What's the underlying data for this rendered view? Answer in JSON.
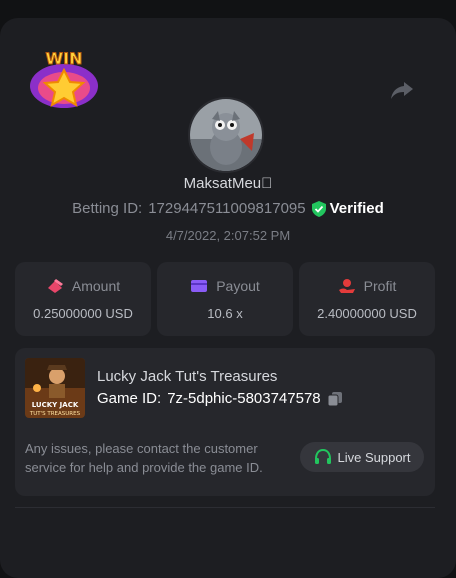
{
  "user": {
    "name": "MaksatMeu\u0000",
    "betting_id_label": "Betting ID:",
    "betting_id": "1729447511009817095",
    "verified_label": "Verified",
    "date": "4/7/2022, 2:07:52 PM"
  },
  "badge": {
    "text": "WIN"
  },
  "stats": [
    {
      "label": "Amount",
      "value": "0.25000000 USD",
      "icon": "chip-icon",
      "color": "#e8466a"
    },
    {
      "label": "Payout",
      "value": "10.6 x",
      "icon": "card-icon",
      "color": "#8a5cf6"
    },
    {
      "label": "Profit",
      "value": "2.40000000 USD",
      "icon": "hand-coin-icon",
      "color": "#e33b3b"
    }
  ],
  "game": {
    "title": "Lucky Jack Tut's Treasures",
    "id_label": "Game ID:",
    "id": "7z-5dphic-5803747578",
    "thumb_line1": "LUCKY JACK",
    "thumb_line2": "TUT'S TREASURES"
  },
  "support": {
    "help_text": "Any issues, please contact the customer service for help and provide the game ID.",
    "button_label": "Live Support"
  },
  "colors": {
    "background": "#111214",
    "card": "#1d1e22",
    "panel": "#26272c",
    "verified": "#22c55e",
    "support_icon": "#22c55e"
  }
}
